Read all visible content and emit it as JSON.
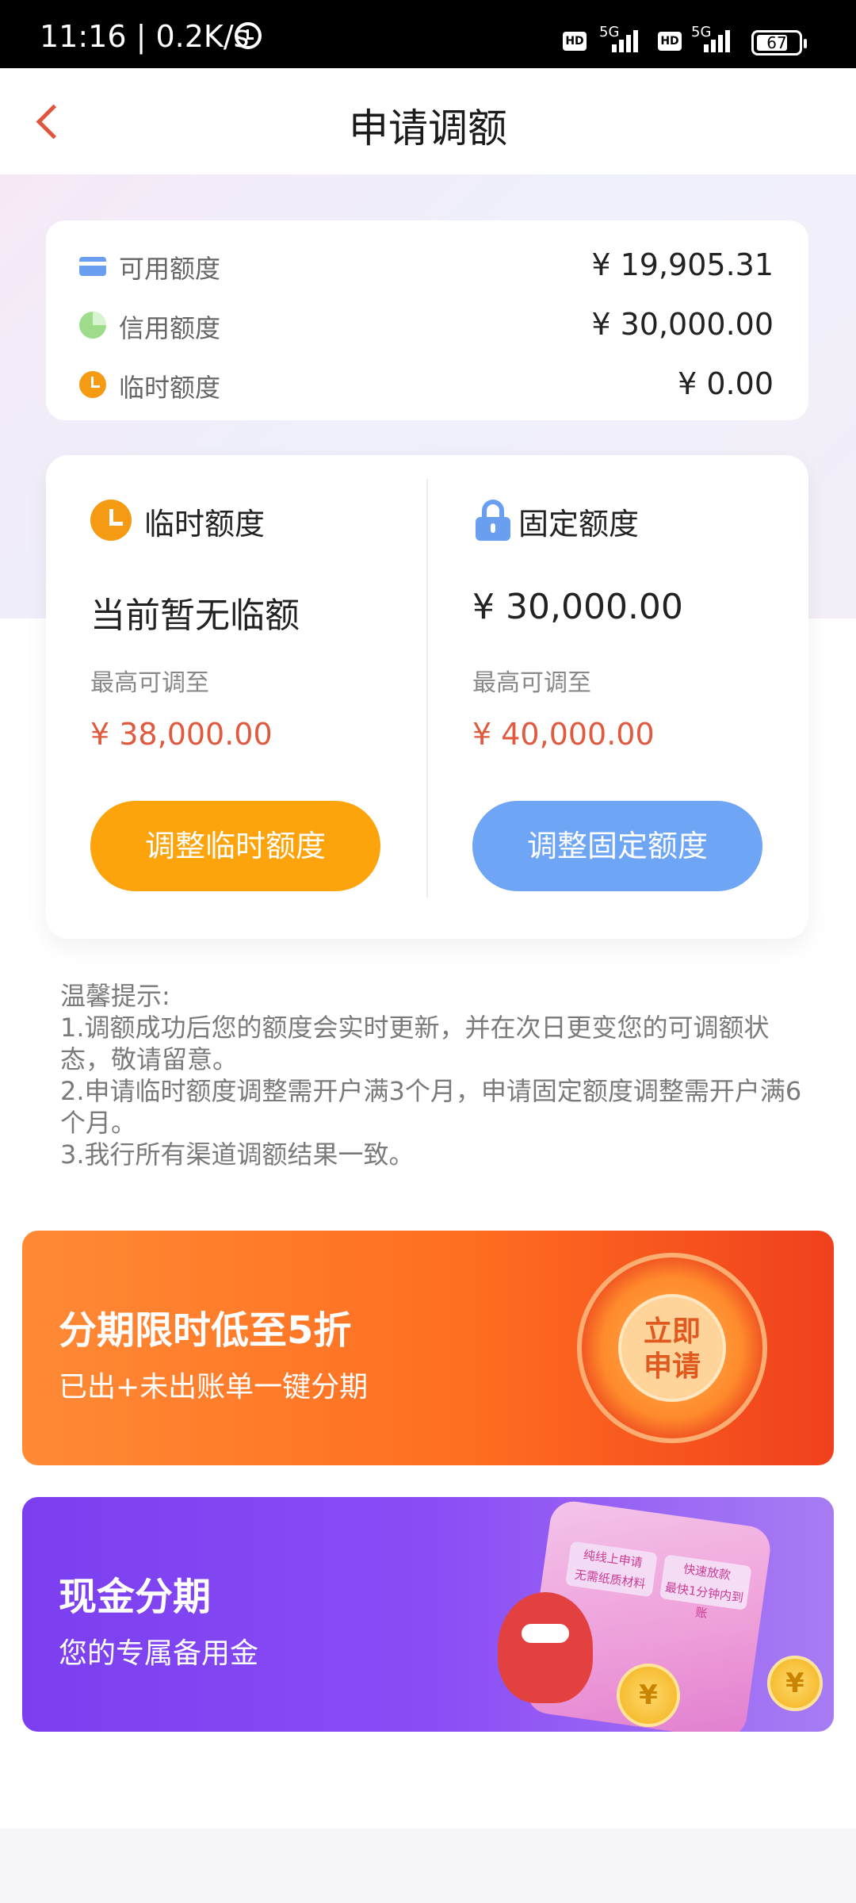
{
  "status_bar": {
    "time": "11:16 | 0.2K/s",
    "hd_label": "HD",
    "network_label": "5G",
    "battery": "67"
  },
  "nav": {
    "title": "申请调额"
  },
  "summary": {
    "rows": [
      {
        "label": "可用额度",
        "value": "¥ 19,905.31",
        "icon": "card-icon",
        "color": "#6a9ff0"
      },
      {
        "label": "信用额度",
        "value": "¥ 30,000.00",
        "icon": "pie-chart-icon",
        "color": "#9edc8c"
      },
      {
        "label": "临时额度",
        "value": "¥ 0.00",
        "icon": "clock-icon",
        "color": "#f59a13"
      }
    ]
  },
  "temp_quota": {
    "title": "临时额度",
    "current": "当前暂无临额",
    "max_label": "最高可调至",
    "max_value": "¥ 38,000.00",
    "button": "调整临时额度",
    "accent": "#fda30b"
  },
  "fixed_quota": {
    "title": "固定额度",
    "current": "¥ 30,000.00",
    "max_label": "最高可调至",
    "max_value": "¥ 40,000.00",
    "button": "调整固定额度",
    "accent": "#6fa5f5"
  },
  "tips": {
    "heading": "温馨提示:",
    "line1": "1.调额成功后您的额度会实时更新，并在次日更变您的可调额状态，敬请留意。",
    "line2": "2.申请临时额度调整需开户满3个月，申请固定额度调整需开户满6个月。",
    "line3": "3.我行所有渠道调额结果一致。"
  },
  "banner_installment": {
    "title": "分期限时低至5折",
    "subtitle": "已出+未出账单一键分期",
    "badge_line1": "立即",
    "badge_line2": "申请"
  },
  "banner_cash": {
    "title": "现金分期",
    "subtitle": "您的专属备用金",
    "tag1_line1": "纯线上申请",
    "tag1_line2": "无需纸质材料",
    "tag2_line1": "快速放款",
    "tag2_line2": "最快1分钟内到账",
    "coin_symbol": "¥"
  },
  "colors": {
    "accent_red": "#e05a3f",
    "orange": "#fda30b",
    "blue": "#6fa5f5"
  }
}
